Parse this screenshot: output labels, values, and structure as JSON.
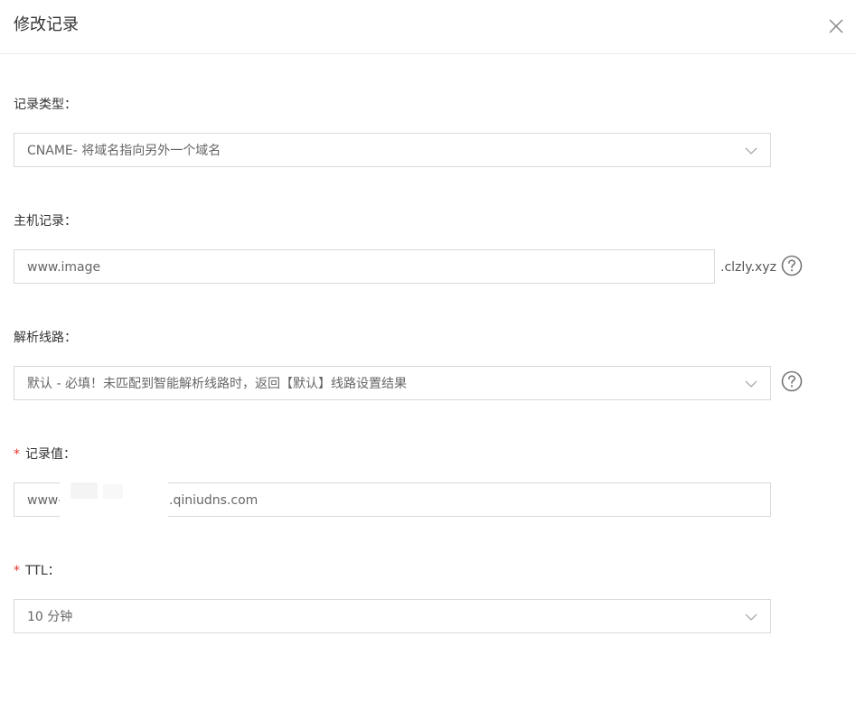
{
  "dialog": {
    "title": "修改记录"
  },
  "fields": {
    "record_type": {
      "label": "记录类型：",
      "value": "CNAME- 将域名指向另外一个域名"
    },
    "host_record": {
      "label": "主机记录：",
      "value": "www.image",
      "suffix": ".clzly.xyz"
    },
    "resolution_line": {
      "label": "解析线路：",
      "value": "默认 - 必填！未匹配到智能解析线路时，返回【默认】线路设置结果"
    },
    "record_value": {
      "required_mark": "*",
      "label": "记录值：",
      "value": "www-",
      "value_suffix": ".qiniudns.com"
    },
    "ttl": {
      "required_mark": "*",
      "label": "TTL：",
      "value": "10 分钟"
    }
  },
  "icons": {
    "close": "close-icon",
    "dropdown": "chevron-down-icon",
    "help": "question-circle-icon"
  },
  "colors": {
    "required": "#e5302a",
    "border": "#d9d9d9",
    "divider": "#e8e8e8"
  }
}
